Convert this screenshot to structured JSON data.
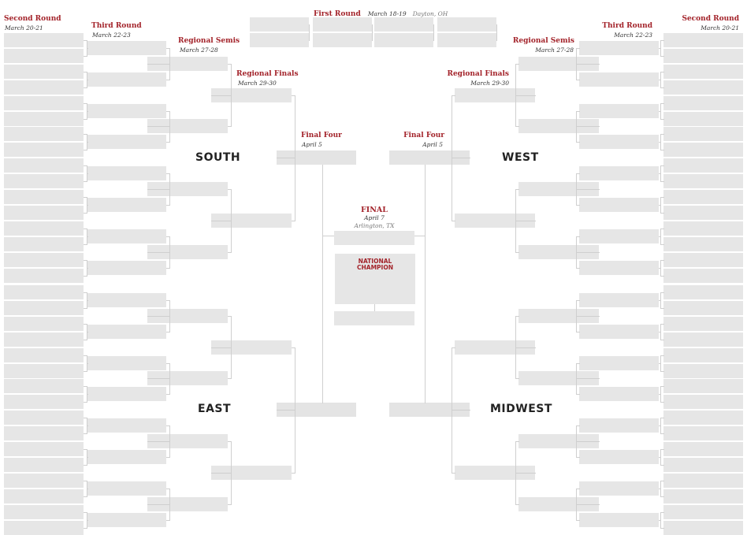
{
  "rounds": {
    "first_round": {
      "title": "First Round",
      "dates": "March 18-19",
      "location": "Dayton, OH"
    },
    "second_round": {
      "title": "Second Round",
      "dates": "March 20-21"
    },
    "third_round": {
      "title": "Third Round",
      "dates": "March 22-23"
    },
    "regional_semis": {
      "title": "Regional Semis",
      "dates": "March 27-28"
    },
    "regional_finals": {
      "title": "Regional Finals",
      "dates": "March 29-30"
    },
    "final_four": {
      "title": "Final Four",
      "dates": "April 5"
    },
    "final": {
      "title": "FINAL",
      "dates": "April 7",
      "location": "Arlington, TX"
    }
  },
  "regions": {
    "top_left": "SOUTH",
    "top_right": "WEST",
    "bottom_left": "EAST",
    "bottom_right": "MIDWEST"
  },
  "champion": {
    "line1": "NATIONAL",
    "line2": "CHAMPION"
  },
  "colors": {
    "accent": "#a3232a",
    "slot": "#e6e6e6",
    "line": "#cfcfcf"
  }
}
